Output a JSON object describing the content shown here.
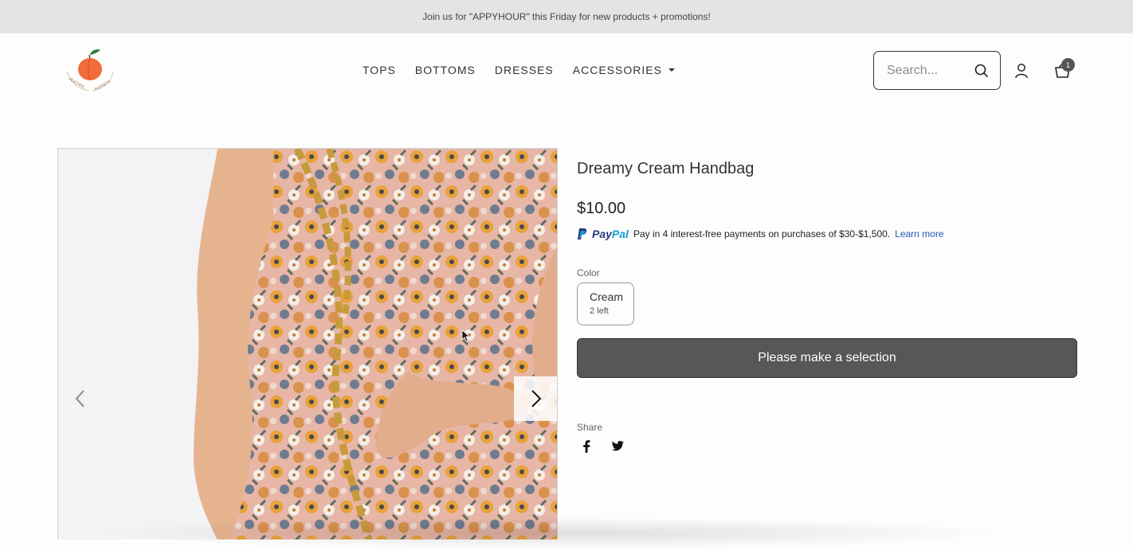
{
  "announcement": "Join us for \"APPYHOUR\" this Friday for new products + promotions!",
  "logo": {
    "text": "PEACHES & POCKETS"
  },
  "nav": {
    "items": [
      "TOPS",
      "BOTTOMS",
      "DRESSES",
      "ACCESSORIES"
    ]
  },
  "search": {
    "placeholder": "Search..."
  },
  "cart": {
    "count": "1"
  },
  "product": {
    "title": "Dreamy Cream Handbag",
    "price": "$10.00",
    "paypal": {
      "logo_pay": "Pay",
      "logo_pal": "Pal",
      "message": "Pay in 4 interest-free payments on purchases of $30-$1,500.",
      "learn_more": "Learn more"
    },
    "color_label": "Color",
    "swatch": {
      "name": "Cream",
      "stock": "2 left"
    },
    "cta": "Please make a selection",
    "share_label": "Share"
  },
  "colors": {
    "accent": "#575757",
    "announcement_bg": "#e4e4e6",
    "paypal_blue": "#253b80",
    "link": "#1f56b4"
  },
  "icons": [
    "peach-logo",
    "search-icon",
    "account-icon",
    "cart-icon",
    "chevron-left-icon",
    "chevron-right-icon",
    "facebook-icon",
    "twitter-icon"
  ]
}
